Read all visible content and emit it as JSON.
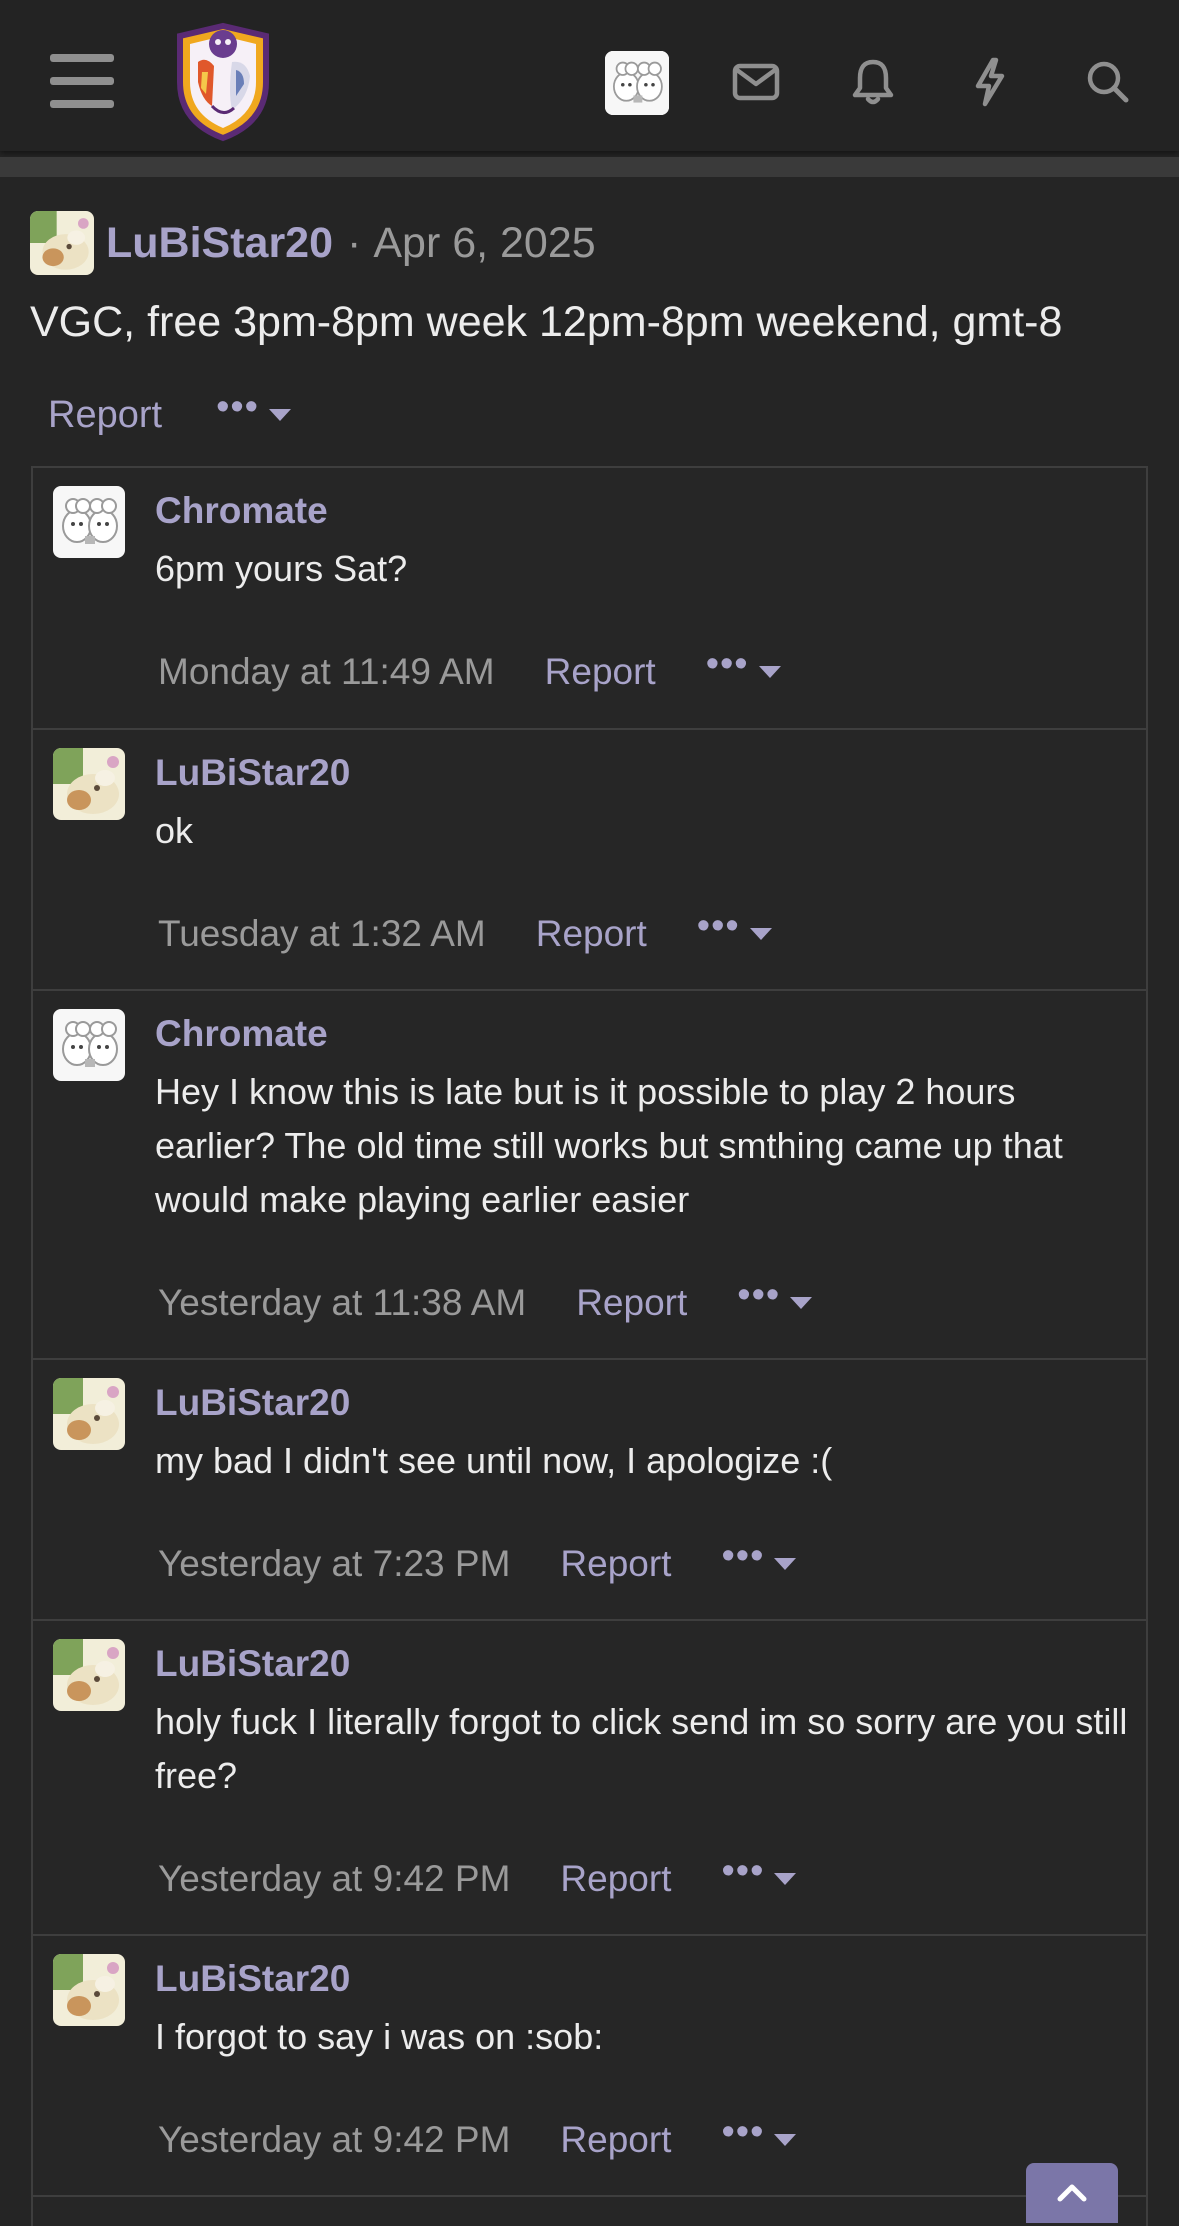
{
  "header": {
    "menu_icon": "hamburger-menu-icon",
    "logo_icon": "site-logo-icon",
    "icons": [
      "inbox-icon",
      "bell-icon",
      "whats-new-icon",
      "search-icon"
    ]
  },
  "post": {
    "author": "LuBiStar20",
    "separator": "·",
    "date": "Apr 6, 2025",
    "body": "VGC, free 3pm-8pm week 12pm-8pm weekend, gmt-8",
    "report_label": "Report",
    "more_label": "•••"
  },
  "comments": [
    {
      "author": "Chromate",
      "avatar": "chromate-avatar",
      "text": "6pm yours Sat?",
      "time": "Monday at 11:49 AM",
      "report_label": "Report",
      "more_label": "•••"
    },
    {
      "author": "LuBiStar20",
      "avatar": "lubistar-avatar",
      "text": "ok",
      "time": "Tuesday at 1:32 AM",
      "report_label": "Report",
      "more_label": "•••"
    },
    {
      "author": "Chromate",
      "avatar": "chromate-avatar",
      "text": "Hey I know this is late but is it possible to play 2 hours earlier? The old time still works but smthing came up that would make playing earlier easier",
      "time": "Yesterday at 11:38 AM",
      "report_label": "Report",
      "more_label": "•••"
    },
    {
      "author": "LuBiStar20",
      "avatar": "lubistar-avatar",
      "text": "my bad I didn't see until now, I apologize :(",
      "time": "Yesterday at 7:23 PM",
      "report_label": "Report",
      "more_label": "•••"
    },
    {
      "author": "LuBiStar20",
      "avatar": "lubistar-avatar",
      "text": "holy fuck I literally forgot to click send im so sorry are you still free?",
      "time": "Yesterday at 9:42 PM",
      "report_label": "Report",
      "more_label": "•••"
    },
    {
      "author": "LuBiStar20",
      "avatar": "lubistar-avatar",
      "text": "I forgot to say i was on :sob:",
      "time": "Yesterday at 9:42 PM",
      "report_label": "Report",
      "more_label": "•••"
    }
  ],
  "colors": {
    "background": "#252525",
    "accent": "#a8a3c9",
    "muted": "#9a9a9a",
    "border": "#3e3e3e",
    "scroll_button": "#7b76a8"
  }
}
